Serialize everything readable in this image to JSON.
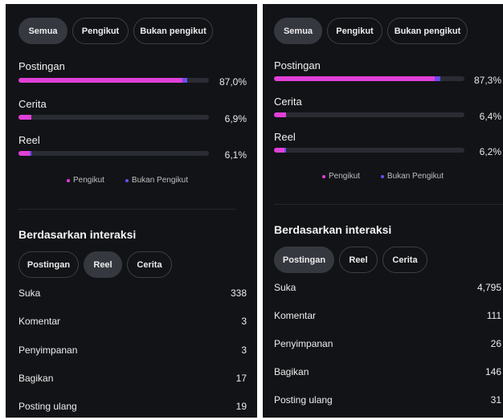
{
  "colors": {
    "background": "#121317",
    "follower": "#e040d8",
    "non_follower": "#6a4cf2"
  },
  "left": {
    "audience_tabs": [
      "Semua",
      "Pengikut",
      "Bukan pengikut"
    ],
    "active_audience_tab": "Semua",
    "metrics": [
      {
        "label": "Postingan",
        "percent": "87,0%",
        "follower_share": 0.862,
        "non_follower_share": 0.026
      },
      {
        "label": "Cerita",
        "percent": "6,9%",
        "follower_share": 0.067,
        "non_follower_share": 0.0
      },
      {
        "label": "Reel",
        "percent": "6,1%",
        "follower_share": 0.057,
        "non_follower_share": 0.004
      }
    ],
    "legend": {
      "follower": "Pengikut",
      "non_follower": "Bukan Pengikut"
    },
    "interaction_title": "Berdasarkan interaksi",
    "interaction_tabs": [
      "Postingan",
      "Reel",
      "Cerita"
    ],
    "active_interaction_tab": "Reel",
    "rows": [
      {
        "label": "Suka",
        "value": "338"
      },
      {
        "label": "Komentar",
        "value": "3"
      },
      {
        "label": "Penyimpanan",
        "value": "3"
      },
      {
        "label": "Bagikan",
        "value": "17"
      },
      {
        "label": "Posting ulang",
        "value": "19"
      }
    ]
  },
  "right": {
    "audience_tabs": [
      "Semua",
      "Pengikut",
      "Bukan pengikut"
    ],
    "active_audience_tab": "Semua",
    "metrics": [
      {
        "label": "Postingan",
        "percent": "87,3%",
        "follower_share": 0.844,
        "non_follower_share": 0.029
      },
      {
        "label": "Cerita",
        "percent": "6,4%",
        "follower_share": 0.064,
        "non_follower_share": 0.0
      },
      {
        "label": "Reel",
        "percent": "6,2%",
        "follower_share": 0.055,
        "non_follower_share": 0.007
      }
    ],
    "legend": {
      "follower": "Pengikut",
      "non_follower": "Bukan Pengikut"
    },
    "interaction_title": "Berdasarkan interaksi",
    "interaction_tabs": [
      "Postingan",
      "Reel",
      "Cerita"
    ],
    "active_interaction_tab": "Postingan",
    "rows": [
      {
        "label": "Suka",
        "value": "4,795"
      },
      {
        "label": "Komentar",
        "value": "111"
      },
      {
        "label": "Penyimpanan",
        "value": "26"
      },
      {
        "label": "Bagikan",
        "value": "146"
      },
      {
        "label": "Posting ulang",
        "value": "31"
      }
    ]
  }
}
